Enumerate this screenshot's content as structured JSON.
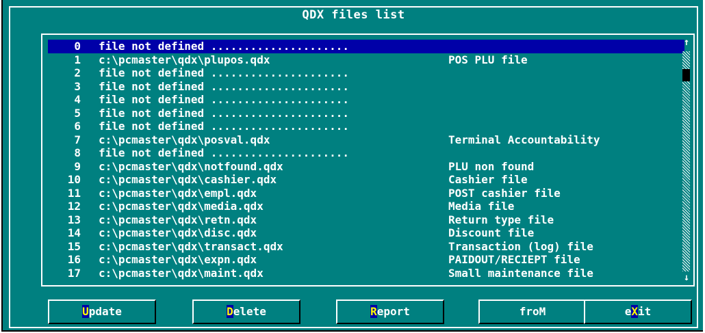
{
  "window": {
    "title": "QDX files list"
  },
  "list": {
    "rows": [
      {
        "num": "0",
        "path": "file not defined .....................",
        "desc": ""
      },
      {
        "num": "1",
        "path": "c:\\pcmaster\\qdx\\plupos.qdx",
        "desc": "POS PLU file"
      },
      {
        "num": "2",
        "path": "file not defined .....................",
        "desc": ""
      },
      {
        "num": "3",
        "path": "file not defined .....................",
        "desc": ""
      },
      {
        "num": "4",
        "path": "file not defined .....................",
        "desc": ""
      },
      {
        "num": "5",
        "path": "file not defined .....................",
        "desc": ""
      },
      {
        "num": "6",
        "path": "file not defined .....................",
        "desc": ""
      },
      {
        "num": "7",
        "path": "c:\\pcmaster\\qdx\\posval.qdx",
        "desc": "Terminal Accountability"
      },
      {
        "num": "8",
        "path": "file not defined .....................",
        "desc": ""
      },
      {
        "num": "9",
        "path": "c:\\pcmaster\\qdx\\notfound.qdx",
        "desc": "PLU non found"
      },
      {
        "num": "10",
        "path": "c:\\pcmaster\\qdx\\cashier.qdx",
        "desc": "Cashier file"
      },
      {
        "num": "11",
        "path": "c:\\pcmaster\\qdx\\empl.qdx",
        "desc": "POST cashier file"
      },
      {
        "num": "12",
        "path": "c:\\pcmaster\\qdx\\media.qdx",
        "desc": "Media file"
      },
      {
        "num": "13",
        "path": "c:\\pcmaster\\qdx\\retn.qdx",
        "desc": "Return type file"
      },
      {
        "num": "14",
        "path": "c:\\pcmaster\\qdx\\disc.qdx",
        "desc": "Discount file"
      },
      {
        "num": "15",
        "path": "c:\\pcmaster\\qdx\\transact.qdx",
        "desc": "Transaction (log) file"
      },
      {
        "num": "16",
        "path": "c:\\pcmaster\\qdx\\expn.qdx",
        "desc": "PAIDOUT/RECIEPT file"
      },
      {
        "num": "17",
        "path": "c:\\pcmaster\\qdx\\maint.qdx",
        "desc": "Small maintenance file"
      }
    ],
    "selected_index": 0,
    "scroll_up_icon": "↑",
    "scroll_down_icon": "↓"
  },
  "buttons": [
    {
      "name": "update-button",
      "hot": "U",
      "rest_before": "",
      "rest_after": "pdate"
    },
    {
      "name": "delete-button",
      "hot": "D",
      "rest_before": "",
      "rest_after": "elete"
    },
    {
      "name": "report-button",
      "hot": "R",
      "rest_before": "",
      "rest_after": "eport"
    },
    {
      "name": "from-button",
      "hot": "",
      "rest_before": "froM",
      "rest_after": ""
    },
    {
      "name": "exit-button",
      "hot": "X",
      "rest_before": "e",
      "rest_after": "it"
    }
  ],
  "colors": {
    "background": "#008080",
    "selected": "#0000a8",
    "text": "#ffffff",
    "hotkey": "#ffff00"
  }
}
